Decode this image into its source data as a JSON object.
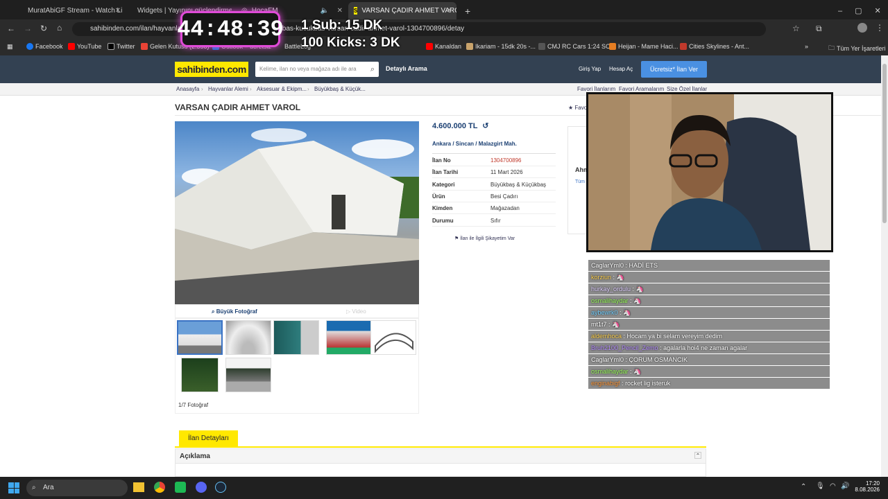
{
  "browser": {
    "tabs": [
      {
        "title": "MuratAbiGF Stream - Watch Li"
      },
      {
        "title": "Widgets | Yayınını güçlendirme"
      },
      {
        "title": "HocaFM"
      },
      {
        "title": "VARSAN ÇADIR AHMET VAROL"
      }
    ],
    "new_tab": "+",
    "url": "sahibinden.com/ilan/hayvanlar-alemi-aksesuar-ekipman-buyukbas-kucukbas-varsan-cadir-ahmet-varol-1304700896/detay",
    "bookmarks": [
      "Facebook",
      "YouTube",
      "Twitter",
      "Gelen Kutusu (2.358)",
      "Outlook – ücretsiz",
      "BattleLog",
      "Kanaldan",
      "Ikariam - 15dk 20s -...",
      "CMJ RC Cars 1:24 SC...",
      "Heijan - Mame Haci...",
      "Cities Skylines - Ant..."
    ],
    "all_bookmarks": "Tüm Yer İşaretleri"
  },
  "overlay": {
    "timer": "44:48:39",
    "sub_text": "1 Sub: 15 DK",
    "kicks_text": "100 Kicks: 3 DK"
  },
  "site": {
    "logo": "sahibinden.com",
    "search_placeholder": "Kelime, ilan no veya mağaza adı ile ara",
    "detailed_search": "Detaylı Arama",
    "login": "Giriş Yap",
    "register": "Hesap Aç",
    "post_ad": "Ücretsiz* İlan Ver",
    "breadcrumbs": [
      "Anasayfa",
      "Hayvanlar Alemi",
      "Aksesuar & Ekipm...",
      "Büyükbaş & Küçük..."
    ],
    "top_links": [
      "Favori İlanlarım",
      "Favori Aramalarım",
      "Size Özel İlanlar"
    ],
    "fav_label": "Favo"
  },
  "listing": {
    "title": "VARSAN ÇADIR AHMET VAROL",
    "price": "4.600.000 TL",
    "location": [
      "Ankara",
      "Sincan",
      "Malazgirt Mah."
    ],
    "details": [
      {
        "key": "İlan No",
        "value": "1304700896"
      },
      {
        "key": "İlan Tarihi",
        "value": "11 Mart 2026"
      },
      {
        "key": "Kategori",
        "value": "Büyükbaş & Küçükbaş"
      },
      {
        "key": "Ürün",
        "value": "Besi Çadırı"
      },
      {
        "key": "Kimden",
        "value": "Mağazadan"
      },
      {
        "key": "Durumu",
        "value": "Sıfır"
      }
    ],
    "complaint": "İlan ile İlgili Şikayetim Var",
    "big_photo": "Büyük Fotoğraf",
    "video": "Video",
    "photo_count": "1/7 Fotoğraf",
    "tab_details": "İlan Detayları",
    "description_label": "Açıklama",
    "seller_initial": "Ahm",
    "seller_link": "Tüm"
  },
  "chat": [
    {
      "user": "CaglarYml0",
      "msg": "HADİ ETS",
      "color": "#ffffff"
    },
    {
      "user": "korziun",
      "msg": "🦄",
      "color": "#ffd24d"
    },
    {
      "user": "hurkay_ordulu",
      "msg": "🦄",
      "color": "#e0d0ff"
    },
    {
      "user": "osmalihaydar",
      "msg": "🦄",
      "color": "#9cff5c"
    },
    {
      "user": "aybewrk0",
      "msg": "🦄",
      "color": "#74d0ff"
    },
    {
      "user": "mt1t7",
      "msg": "🦄",
      "color": "#ffffff"
    },
    {
      "user": "aldemhoca",
      "msg": "Hocam ya bi selam vereyim dedim",
      "color": "#ffd24d"
    },
    {
      "user": "Bruh2100_Pencil_Zemo",
      "msg": "agalarla hoi4 ne zaman agalar",
      "color": "#b48cff"
    },
    {
      "user": "CaglarYml0",
      "msg": "ÇORUM OSMANCIK",
      "color": "#ffffff"
    },
    {
      "user": "osmalihaydar",
      "msg": "🦄",
      "color": "#9cff5c"
    },
    {
      "user": "enginabigf",
      "msg": "rocket lig isteruk",
      "color": "#ff9a3c"
    }
  ],
  "taskbar": {
    "search": "Ara",
    "time": "17:20",
    "date": "8.08.2026"
  }
}
